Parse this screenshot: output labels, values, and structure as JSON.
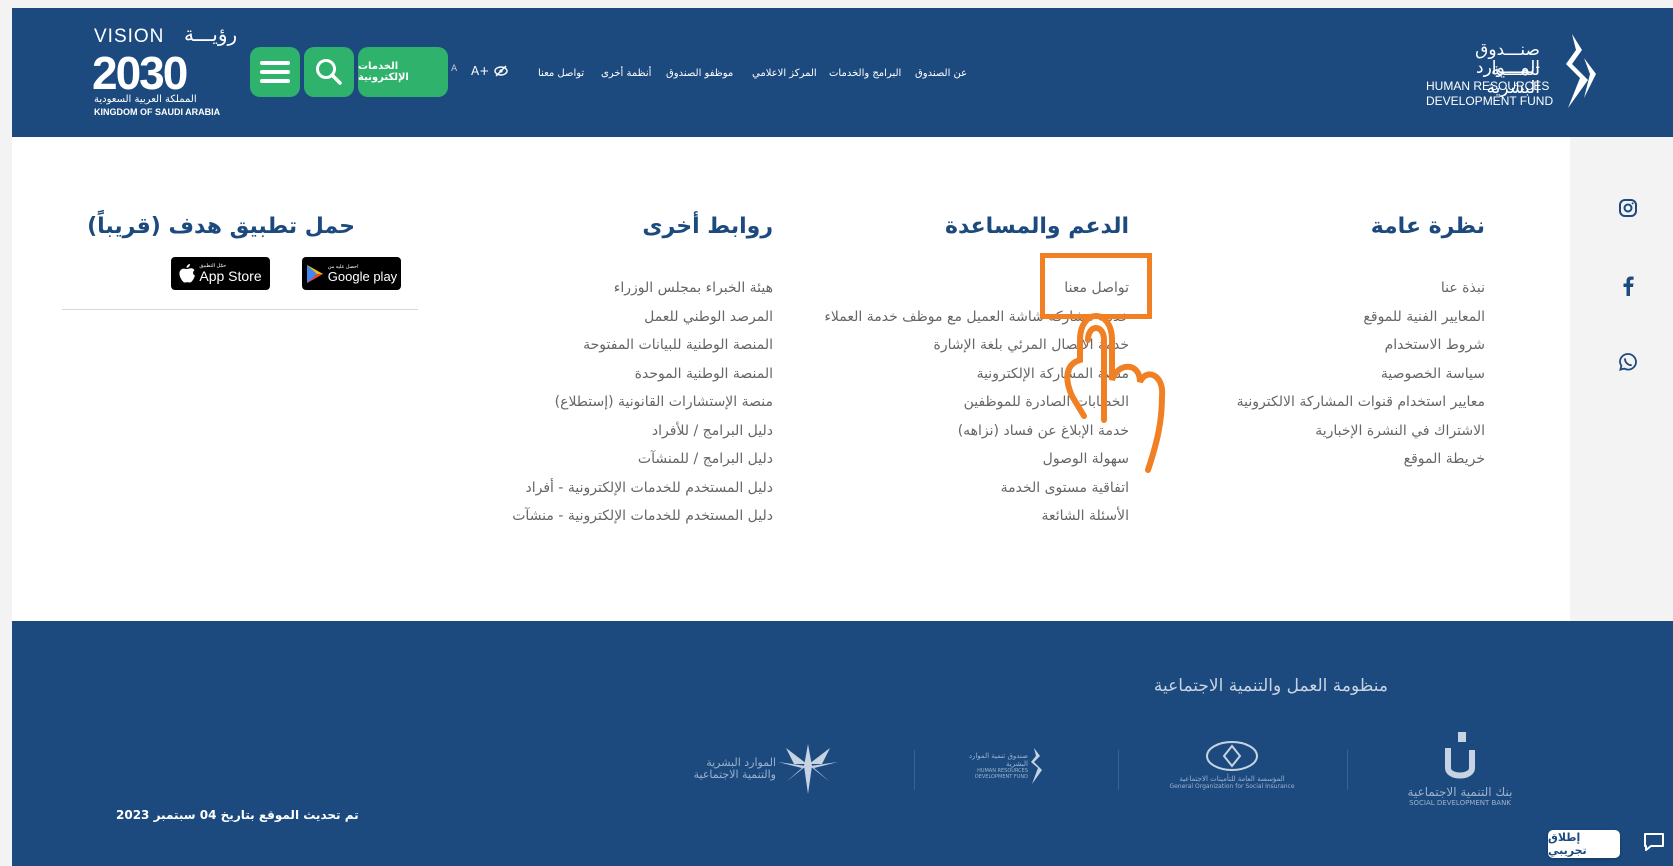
{
  "header": {
    "vision": {
      "en": "VISION",
      "ar": "رؤيـــة",
      "year": "2030",
      "kingdom_ar": "المملكة العربية السعودية",
      "kingdom_en": "KINGDOM OF SAUDI ARABIA"
    },
    "eservices_label": "الخدمات الإلكترونية",
    "font_decrease": "A",
    "font_increase": "A+",
    "nav": [
      "عن الصندوق",
      "البرامج والخدمات",
      "المركز الاعلامي",
      "موظفو الصندوق",
      "أنظمة أخرى",
      "تواصل معنا"
    ],
    "logo": {
      "ar1": "صنـــدوق تنمـــية",
      "ar2": "المـــوارد البشرية",
      "en1": "HUMAN RESOURCES",
      "en2": "DEVELOPMENT FUND"
    }
  },
  "columns": {
    "overview": {
      "title": "نظرة عامة",
      "items": [
        "نبذة عنا",
        "المعايير الفنية للموقع",
        "شروط الاستخدام",
        "سياسة الخصوصية",
        "معايير استخدام قنوات المشاركة الالكترونية",
        "الاشتراك في النشرة الإخبارية",
        "خريطة الموقع"
      ]
    },
    "support": {
      "title": "الدعم والمساعدة",
      "items": [
        "تواصل معنا",
        "خدمة مشاركة شاشة العميل مع موظف خدمة العملاء",
        "خدمة الاتصال المرئي بلغة الإشارة",
        "منصة المشاركة الإلكترونية",
        "الخطابات الصادرة للموظفين",
        "خدمة الإبلاغ عن فساد (نزاهه)",
        "سهولة الوصول",
        "اتفاقية مستوى الخدمة",
        "الأسئلة الشائعة"
      ]
    },
    "links": {
      "title": "روابط أخرى",
      "items": [
        "هيئة الخبراء بمجلس الوزراء",
        "المرصد الوطني للعمل",
        "المنصة الوطنية للبيانات المفتوحة",
        "المنصة الوطنية الموحدة",
        "منصة الإستشارات القانونية (إستطلاع)",
        "دليل البرامج / للأفراد",
        "دليل البرامج / للمنشآت",
        "دليل المستخدم للخدمات الإلكترونية - أفراد",
        "دليل المستخدم للخدمات الإلكترونية - منشآت"
      ]
    },
    "app": {
      "title": "حمل تطبيق هدف (قريباً)",
      "google_small": "احصل عليه من",
      "google_label": "Google play",
      "apple_small": "حمّل التطبيق",
      "apple_label": "App Store"
    }
  },
  "footer": {
    "title": "منظومة العمل والتنمية الاجتماعية",
    "partners": [
      {
        "ar": "بنك التنمية الاجتماعية",
        "en": "SOCIAL DEVELOPMENT BANK"
      },
      {
        "ar": "المؤسسة العامة للتأمينات الاجتماعية",
        "en": "General Organization for Social Insurance"
      },
      {
        "ar": "صندوق تنمية الموارد البشرية",
        "en": "HUMAN RESOURCES DEVELOPMENT FUND"
      },
      {
        "ar": "الموارد البشرية والتنمية الاجتماعية",
        "en": ""
      }
    ],
    "updated": "تم تحديث الموقع بتاريخ 04 سبتمبر 2023"
  },
  "side": {
    "more": "---",
    "beta_label": "إطلاق تجريبي"
  },
  "colors": {
    "primary": "#1c4a7e",
    "green": "#2fb26b",
    "highlight": "#f08023"
  }
}
